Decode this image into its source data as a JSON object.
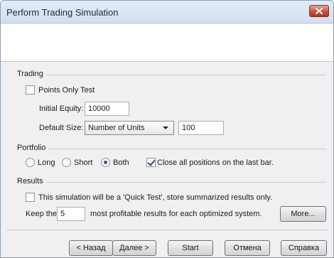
{
  "window": {
    "title": "Perform Trading Simulation"
  },
  "trading": {
    "section_label": "Trading",
    "points_only_label": "Points Only Test",
    "points_only_checked": false,
    "initial_equity_label": "Initial Equity:",
    "initial_equity_value": "10000",
    "default_size_label": "Default Size:",
    "default_size_selected": "Number of Units",
    "default_size_value": "100"
  },
  "portfolio": {
    "section_label": "Portfolio",
    "options": [
      "Long",
      "Short",
      "Both"
    ],
    "selected": "Both",
    "close_all_label": "Close all positions on the last bar.",
    "close_all_checked": true
  },
  "results": {
    "section_label": "Results",
    "quick_test_label": "This simulation will be a 'Quick Test', store summarized results only.",
    "quick_test_checked": false,
    "keep_prefix": "Keep the",
    "keep_value": "5",
    "keep_suffix": "most profitable results for each optimized system.",
    "more_label": "More..."
  },
  "footer": {
    "back_label": "< Назад",
    "next_label": "Далее >",
    "start_label": "Start",
    "cancel_label": "Отмена",
    "help_label": "Справка"
  },
  "icons": {
    "close": "close-x-icon",
    "dropdown": "chevron-down-icon"
  }
}
